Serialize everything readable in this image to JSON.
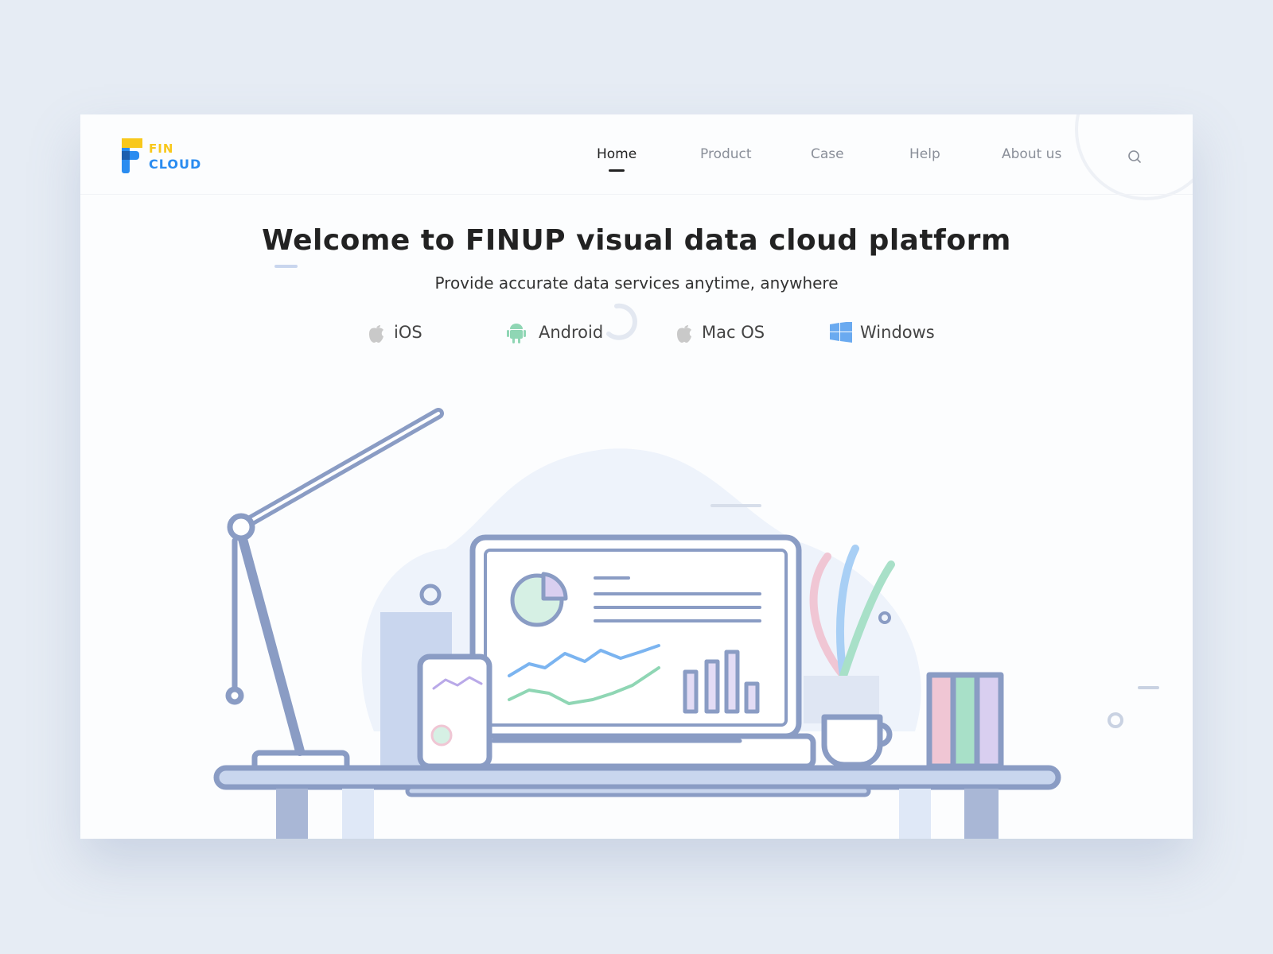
{
  "logo": {
    "line1": "FIN",
    "line2": "CLOUD"
  },
  "nav": {
    "items": [
      {
        "label": "Home",
        "active": true
      },
      {
        "label": "Product",
        "active": false
      },
      {
        "label": "Case",
        "active": false
      },
      {
        "label": "Help",
        "active": false
      },
      {
        "label": "About us",
        "active": false
      }
    ],
    "search_icon": "search-icon"
  },
  "hero": {
    "title": "Welcome to FINUP visual data cloud platform",
    "subtitle": "Provide accurate data services anytime, anywhere"
  },
  "platforms": [
    {
      "label": "iOS",
      "icon": "apple-icon"
    },
    {
      "label": "Android",
      "icon": "android-icon"
    },
    {
      "label": "Mac OS",
      "icon": "apple-icon"
    },
    {
      "label": "Windows",
      "icon": "windows-icon"
    }
  ],
  "colors": {
    "accent_yellow": "#f8c81c",
    "accent_blue": "#2a8cf0",
    "illustration": "#8a9cc4"
  }
}
